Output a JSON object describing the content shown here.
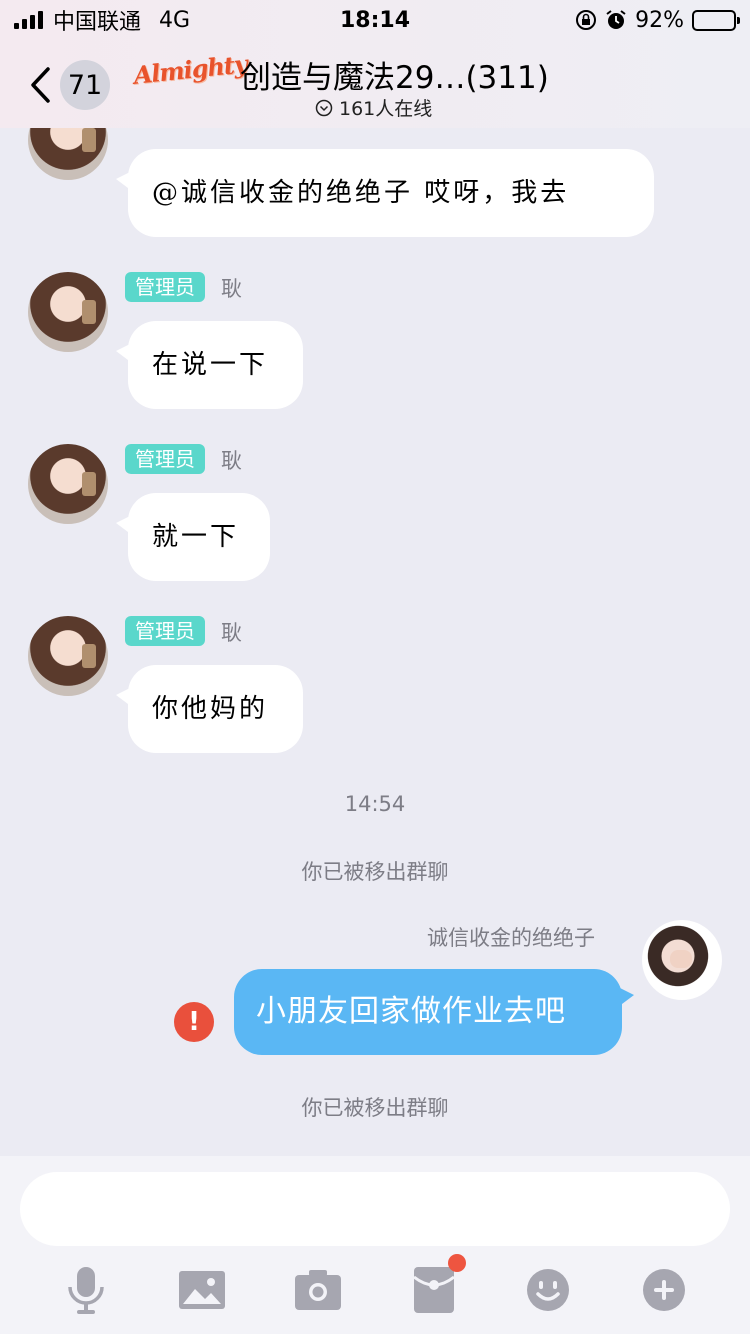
{
  "status_bar": {
    "carrier": "中国联通",
    "network": "4G",
    "time": "18:14",
    "battery_text": "92%",
    "battery_level": 0.92
  },
  "header": {
    "back_count": "71",
    "logo_text": "Almighty",
    "title": "创造与魔法29…(311)",
    "online_text": "161人在线"
  },
  "messages": [
    {
      "role": "",
      "nick": "",
      "text": "@诚信收金的绝绝子 哎呀，我去"
    },
    {
      "role": "管理员",
      "nick": "耿",
      "text": "在说一下"
    },
    {
      "role": "管理员",
      "nick": "耿",
      "text": "就一下"
    },
    {
      "role": "管理员",
      "nick": "耿",
      "text": "你他妈的"
    }
  ],
  "system": {
    "timestamp": "14:54",
    "removed_1": "你已被移出群聊",
    "removed_2": "你已被移出群聊"
  },
  "my_message": {
    "nick": "诚信收金的绝绝子",
    "text": "小朋友回家做作业去吧",
    "error_mark": "!"
  },
  "input": {
    "placeholder": ""
  },
  "toolbar": {
    "icons": [
      "microphone-icon",
      "image-icon",
      "camera-icon",
      "red-packet-icon",
      "emoji-icon",
      "plus-icon"
    ],
    "red_packet_badge": true
  },
  "colors": {
    "role_badge": "#5ad7cb",
    "my_bubble": "#5ab7f4",
    "error": "#e9503c",
    "icon_gray": "#a6a6b0"
  }
}
